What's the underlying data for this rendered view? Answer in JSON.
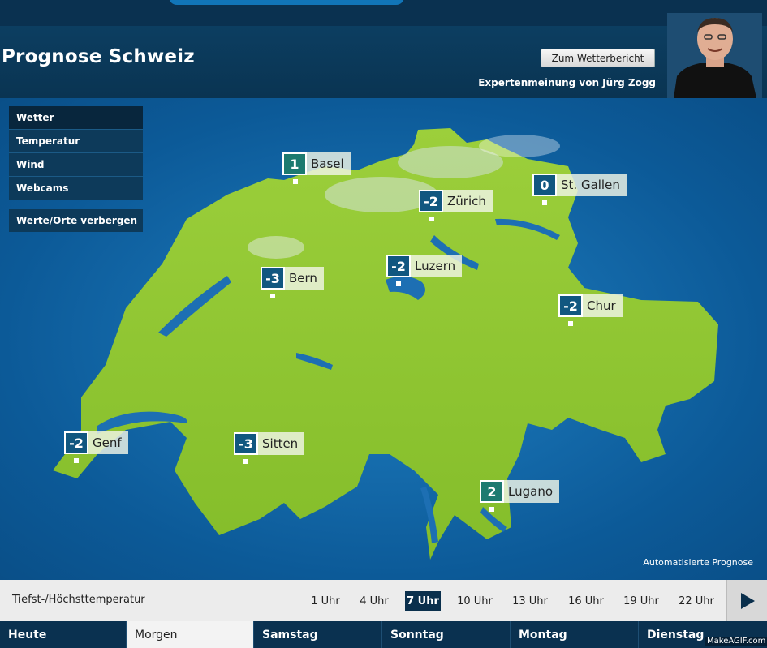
{
  "header": {
    "title": "Prognose Schweiz",
    "report_button": "Zum Wetterbericht",
    "expert": "Expertenmeinung von Jürg Zogg"
  },
  "menu": {
    "items": [
      {
        "label": "Wetter",
        "active": true
      },
      {
        "label": "Temperatur",
        "active": false
      },
      {
        "label": "Wind",
        "active": false
      },
      {
        "label": "Webcams",
        "active": false
      }
    ],
    "hide_label": "Werte/Orte verbergen"
  },
  "cities": [
    {
      "name": "Basel",
      "temp": "1"
    },
    {
      "name": "St. Gallen",
      "temp": "0"
    },
    {
      "name": "Zürich",
      "temp": "-2"
    },
    {
      "name": "Luzern",
      "temp": "-2"
    },
    {
      "name": "Bern",
      "temp": "-3"
    },
    {
      "name": "Chur",
      "temp": "-2"
    },
    {
      "name": "Genf",
      "temp": "-2"
    },
    {
      "name": "Sitten",
      "temp": "-3"
    },
    {
      "name": "Lugano",
      "temp": "2"
    }
  ],
  "map_note": "Automatisierte Prognose",
  "timebar": {
    "label": "Tiefst-/Höchsttemperatur",
    "times": [
      "1 Uhr",
      "4 Uhr",
      "7 Uhr",
      "10 Uhr",
      "13 Uhr",
      "16 Uhr",
      "19 Uhr",
      "22 Uhr"
    ],
    "selected": "7 Uhr"
  },
  "days": [
    "Heute",
    "Morgen",
    "Samstag",
    "Sonntag",
    "Montag",
    "Dienstag"
  ],
  "selected_day": "Morgen",
  "watermark": "MakeAGIF.com",
  "colors": {
    "land": "#8fc92f",
    "lake": "#1d6fb3",
    "header": "#0a3150",
    "temp_box": "#115780",
    "temp_box_warm": "#1c7a70"
  }
}
